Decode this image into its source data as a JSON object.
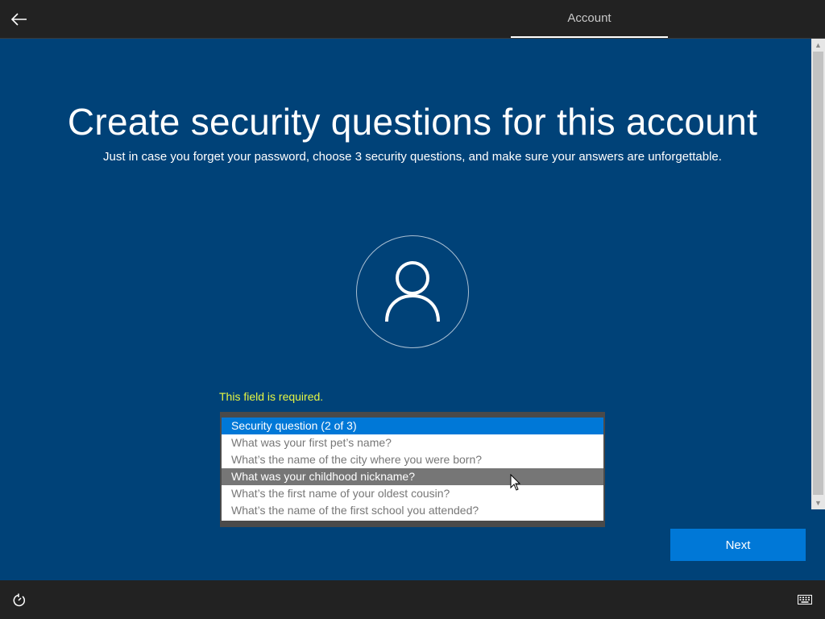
{
  "header": {
    "back_icon": "arrow-left-icon",
    "tab_label": "Account"
  },
  "main": {
    "title": "Create security questions for this account",
    "subtitle": "Just in case you forget your password, choose 3 security questions, and make sure your answers are unforgettable.",
    "avatar_icon": "user-icon",
    "error_text": "This field is required.",
    "error_color": "#e6f542",
    "dropdown": {
      "selected": "Security question (2 of 3)",
      "options": [
        "What was your first pet’s name?",
        "What’s the name of the city where you were born?",
        "What was your childhood nickname?",
        "What’s the first name of your oldest cousin?",
        "What’s the name of the first school you attended?"
      ],
      "hovered_index": 2
    },
    "next_label": "Next"
  },
  "footer": {
    "ease_icon": "ease-of-access-icon",
    "keyboard_icon": "keyboard-icon"
  },
  "colors": {
    "background": "#004278",
    "accent": "#0078d7",
    "bar": "#222222"
  }
}
